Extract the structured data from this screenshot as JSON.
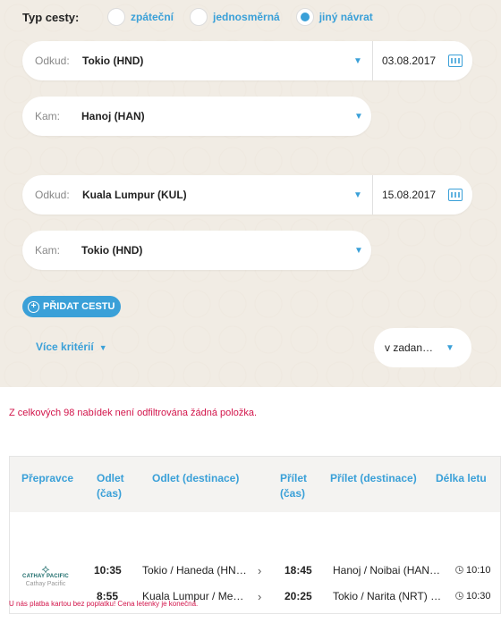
{
  "trip_type": {
    "label": "Typ cesty:",
    "options": [
      {
        "label": "zpáteční",
        "checked": false
      },
      {
        "label": "jednosměrná",
        "checked": false
      },
      {
        "label": "jiný návrat",
        "checked": true
      }
    ]
  },
  "segments": [
    {
      "from_label": "Odkud:",
      "from_value": "Tokio (HND)",
      "date": "03.08.2017",
      "to_label": "Kam:",
      "to_value": "Hanoj (HAN)"
    },
    {
      "from_label": "Odkud:",
      "from_value": "Kuala Lumpur (KUL)",
      "date": "15.08.2017",
      "to_label": "Kam:",
      "to_value": "Tokio (HND)"
    }
  ],
  "add_trip_label": "PŘIDAT CESTU",
  "more_criteria_label": "Více kritérií",
  "sort_select_value": "v zadan…",
  "filter_note": "Z celkových 98 nabídek není odfiltrována žádná položka.",
  "table": {
    "headers": [
      "Přepravce",
      "Odlet (čas)",
      "Odlet (destinace)",
      "Přílet (čas)",
      "Přílet (destinace)",
      "Délka letu"
    ],
    "header_odlet_1": "Odlet",
    "header_odlet_2": "(čas)",
    "header_prilet_1": "Přílet",
    "header_prilet_2": "(čas)",
    "carrier": {
      "brand": "CATHAY PACIFIC",
      "name": "Cathay Pacific"
    },
    "rows": [
      {
        "dep_time": "10:35",
        "dep_dest": "Tokio / Haneda (HN…",
        "arr_time": "18:45",
        "arr_dest": "Hanoj / Noibai (HAN…",
        "duration": "10:10"
      },
      {
        "dep_time": "8:55",
        "dep_dest": "Kuala Lumpur / Me…",
        "arr_time": "20:25",
        "arr_dest": "Tokio / Narita (NRT) …",
        "duration": "10:30"
      }
    ]
  },
  "payment_note": "U nás platba kartou bez poplatku! Cena letenky je konečná.",
  "colors": {
    "accent": "#3aa0d8",
    "alert": "#d2144a",
    "panel": "#f1ece4"
  },
  "icons": [
    "radio-icon",
    "chevron-down-icon",
    "calendar-icon",
    "plus-circle-icon",
    "chevron-right-icon",
    "clock-icon",
    "airline-logo-icon"
  ]
}
